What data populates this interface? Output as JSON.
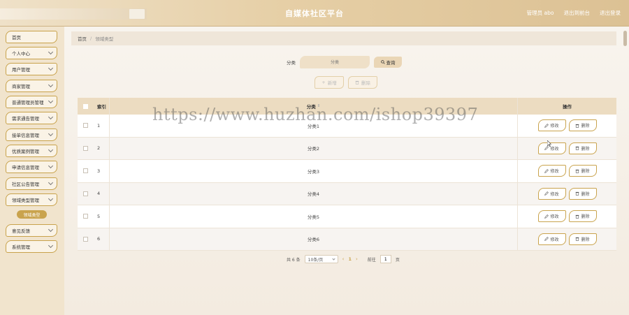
{
  "header": {
    "title": "自媒体社区平台",
    "links": [
      "管理员 abo",
      "退出到前台",
      "退出登录"
    ]
  },
  "sidebar": {
    "items": [
      {
        "label": "首页",
        "chevron": false
      },
      {
        "label": "个人中心",
        "chevron": true
      },
      {
        "label": "用户管理",
        "chevron": true
      },
      {
        "label": "商家管理",
        "chevron": true
      },
      {
        "label": "普通管理员管理",
        "chevron": true
      },
      {
        "label": "需求通告管理",
        "chevron": true
      },
      {
        "label": "接单信息管理",
        "chevron": true
      },
      {
        "label": "优质案例管理",
        "chevron": true
      },
      {
        "label": "申请信息管理",
        "chevron": true
      },
      {
        "label": "社区公告管理",
        "chevron": true
      },
      {
        "label": "领域类型管理",
        "chevron": true
      },
      {
        "label": "意见反馈",
        "chevron": true
      },
      {
        "label": "系统管理",
        "chevron": true
      }
    ],
    "active_sub": "领域类型"
  },
  "breadcrumb": {
    "home": "首页",
    "sep": "/",
    "current": "领域类型"
  },
  "search": {
    "label": "分类",
    "placeholder": "分类",
    "button": "查询"
  },
  "actions": {
    "add": "新增",
    "delete": "删除"
  },
  "table": {
    "headers": {
      "index": "索引",
      "category": "分类",
      "ops": "操作"
    },
    "rows": [
      {
        "index": "1",
        "category": "分类1"
      },
      {
        "index": "2",
        "category": "分类2"
      },
      {
        "index": "3",
        "category": "分类3"
      },
      {
        "index": "4",
        "category": "分类4"
      },
      {
        "index": "5",
        "category": "分类5"
      },
      {
        "index": "6",
        "category": "分类6"
      }
    ],
    "edit_label": "修改",
    "delete_label": "删除"
  },
  "pagination": {
    "total": "共 6 条",
    "page_size": "10条/页",
    "current_page": "1",
    "goto_label": "前往",
    "goto_value": "1",
    "page_unit": "页"
  },
  "watermark": "https://www.huzhan.com/ishop39397",
  "colors": {
    "accent": "#c9a34d",
    "header_bg": "#e6cfa6",
    "table_head": "#ecdcc1"
  }
}
